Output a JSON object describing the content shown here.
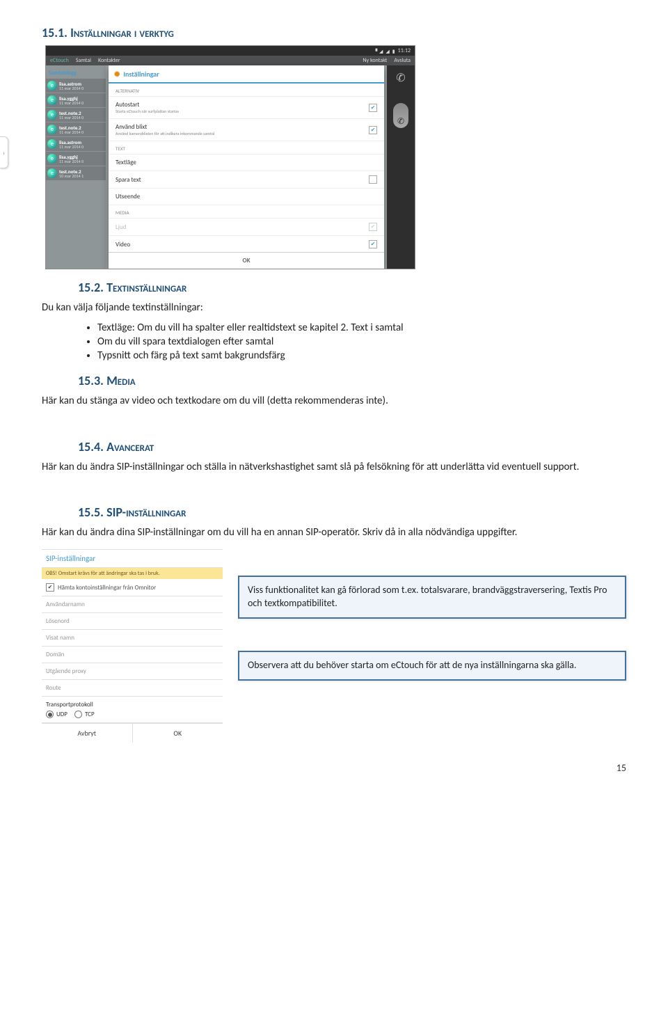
{
  "sec151": {
    "num": "15.1.",
    "title": "Inställningar i verktyg"
  },
  "sec152": {
    "num": "15.2.",
    "title": "Textinställningar"
  },
  "sec153": {
    "num": "15.3.",
    "title": "Media"
  },
  "sec154": {
    "num": "15.4.",
    "title": "Avancerat"
  },
  "sec155": {
    "num": "15.5.",
    "title": "SIP-inställningar"
  },
  "p152_intro": "Du kan välja följande textinställningar:",
  "bullets": {
    "b1": "Textläge: Om du vill ha spalter eller realtidstext se kapitel 2. Text i samtal",
    "b2": "Om du vill spara textdialogen efter samtal",
    "b3": "Typsnitt och färg på text samt bakgrundsfärg"
  },
  "p153": "Här kan du stänga av video och textkodare om du vill (detta rekommenderas inte).",
  "p154": "Här kan du ändra SIP-inställningar och ställa in nätverkshastighet samt slå på felsökning för att underlätta vid eventuell support.",
  "p155": "Här kan du ändra dina SIP-inställningar om du vill ha en annan SIP-operatör. Skriv då in alla nödvändiga uppgifter.",
  "callout1": "Viss funktionalitet kan gå förlorad som t.ex. totalsvarare, brandväggstraversering, Textis Pro och textkompatibilitet.",
  "callout2": "Observera att du behöver starta om eCtouch för att de nya inställningarna ska gälla.",
  "pagenum": "15",
  "shot1": {
    "time": "11:12",
    "brand": "eCtouch",
    "appbar": {
      "samtal": "Samtal",
      "kontakter": "Kontakter",
      "nykontakt": "Ny kontakt",
      "avsluta": "Avsluta"
    },
    "leftTitle": "Samtalslogg",
    "log": [
      {
        "name": "lisa.astrom",
        "date": "11 mar 2014 0"
      },
      {
        "name": "lisa.ygghj",
        "date": "11 mar 2014 0"
      },
      {
        "name": "test.note.2",
        "date": "11 mar 2014 0"
      },
      {
        "name": "test.note.2",
        "date": "11 mar 2014 0"
      },
      {
        "name": "lisa.astrom",
        "date": "11 mar 2014 0"
      },
      {
        "name": "lisa.ygghj",
        "date": "11 mar 2014 0"
      },
      {
        "name": "test.note.2",
        "date": "10 mar 2014 1"
      }
    ],
    "dlg": {
      "title": "Inställningar",
      "sect_alt": "ALTERNATIV",
      "row_auto": {
        "label": "Autostart",
        "sub": "Starta eCtouch när surfplattan startas"
      },
      "row_blixt": {
        "label": "Använd blixt",
        "sub": "Använd kamerablixten för att indikera inkommande samtal"
      },
      "sect_text": "TEXT",
      "row_textlage": "Textläge",
      "row_spara": "Spara text",
      "row_utseende": "Utseende",
      "sect_media": "MEDIA",
      "row_ljud": "Ljud",
      "row_video": "Video",
      "ok": "OK"
    }
  },
  "shot2": {
    "title": "SIP-inställningar",
    "warn": "OBS! Omstart krävs för att ändringar ska tas i bruk.",
    "fetch": "Hämta kontoinställningar från Omnitor",
    "fields": {
      "user": "Användarnamn",
      "pass": "Lösenord",
      "disp": "Visat namn",
      "domain": "Domän",
      "proxy": "Utgående proxy",
      "route": "Route",
      "transport": "Transportprotokoll",
      "udp": "UDP",
      "tcp": "TCP"
    },
    "buttons": {
      "cancel": "Avbryt",
      "ok": "OK"
    }
  }
}
